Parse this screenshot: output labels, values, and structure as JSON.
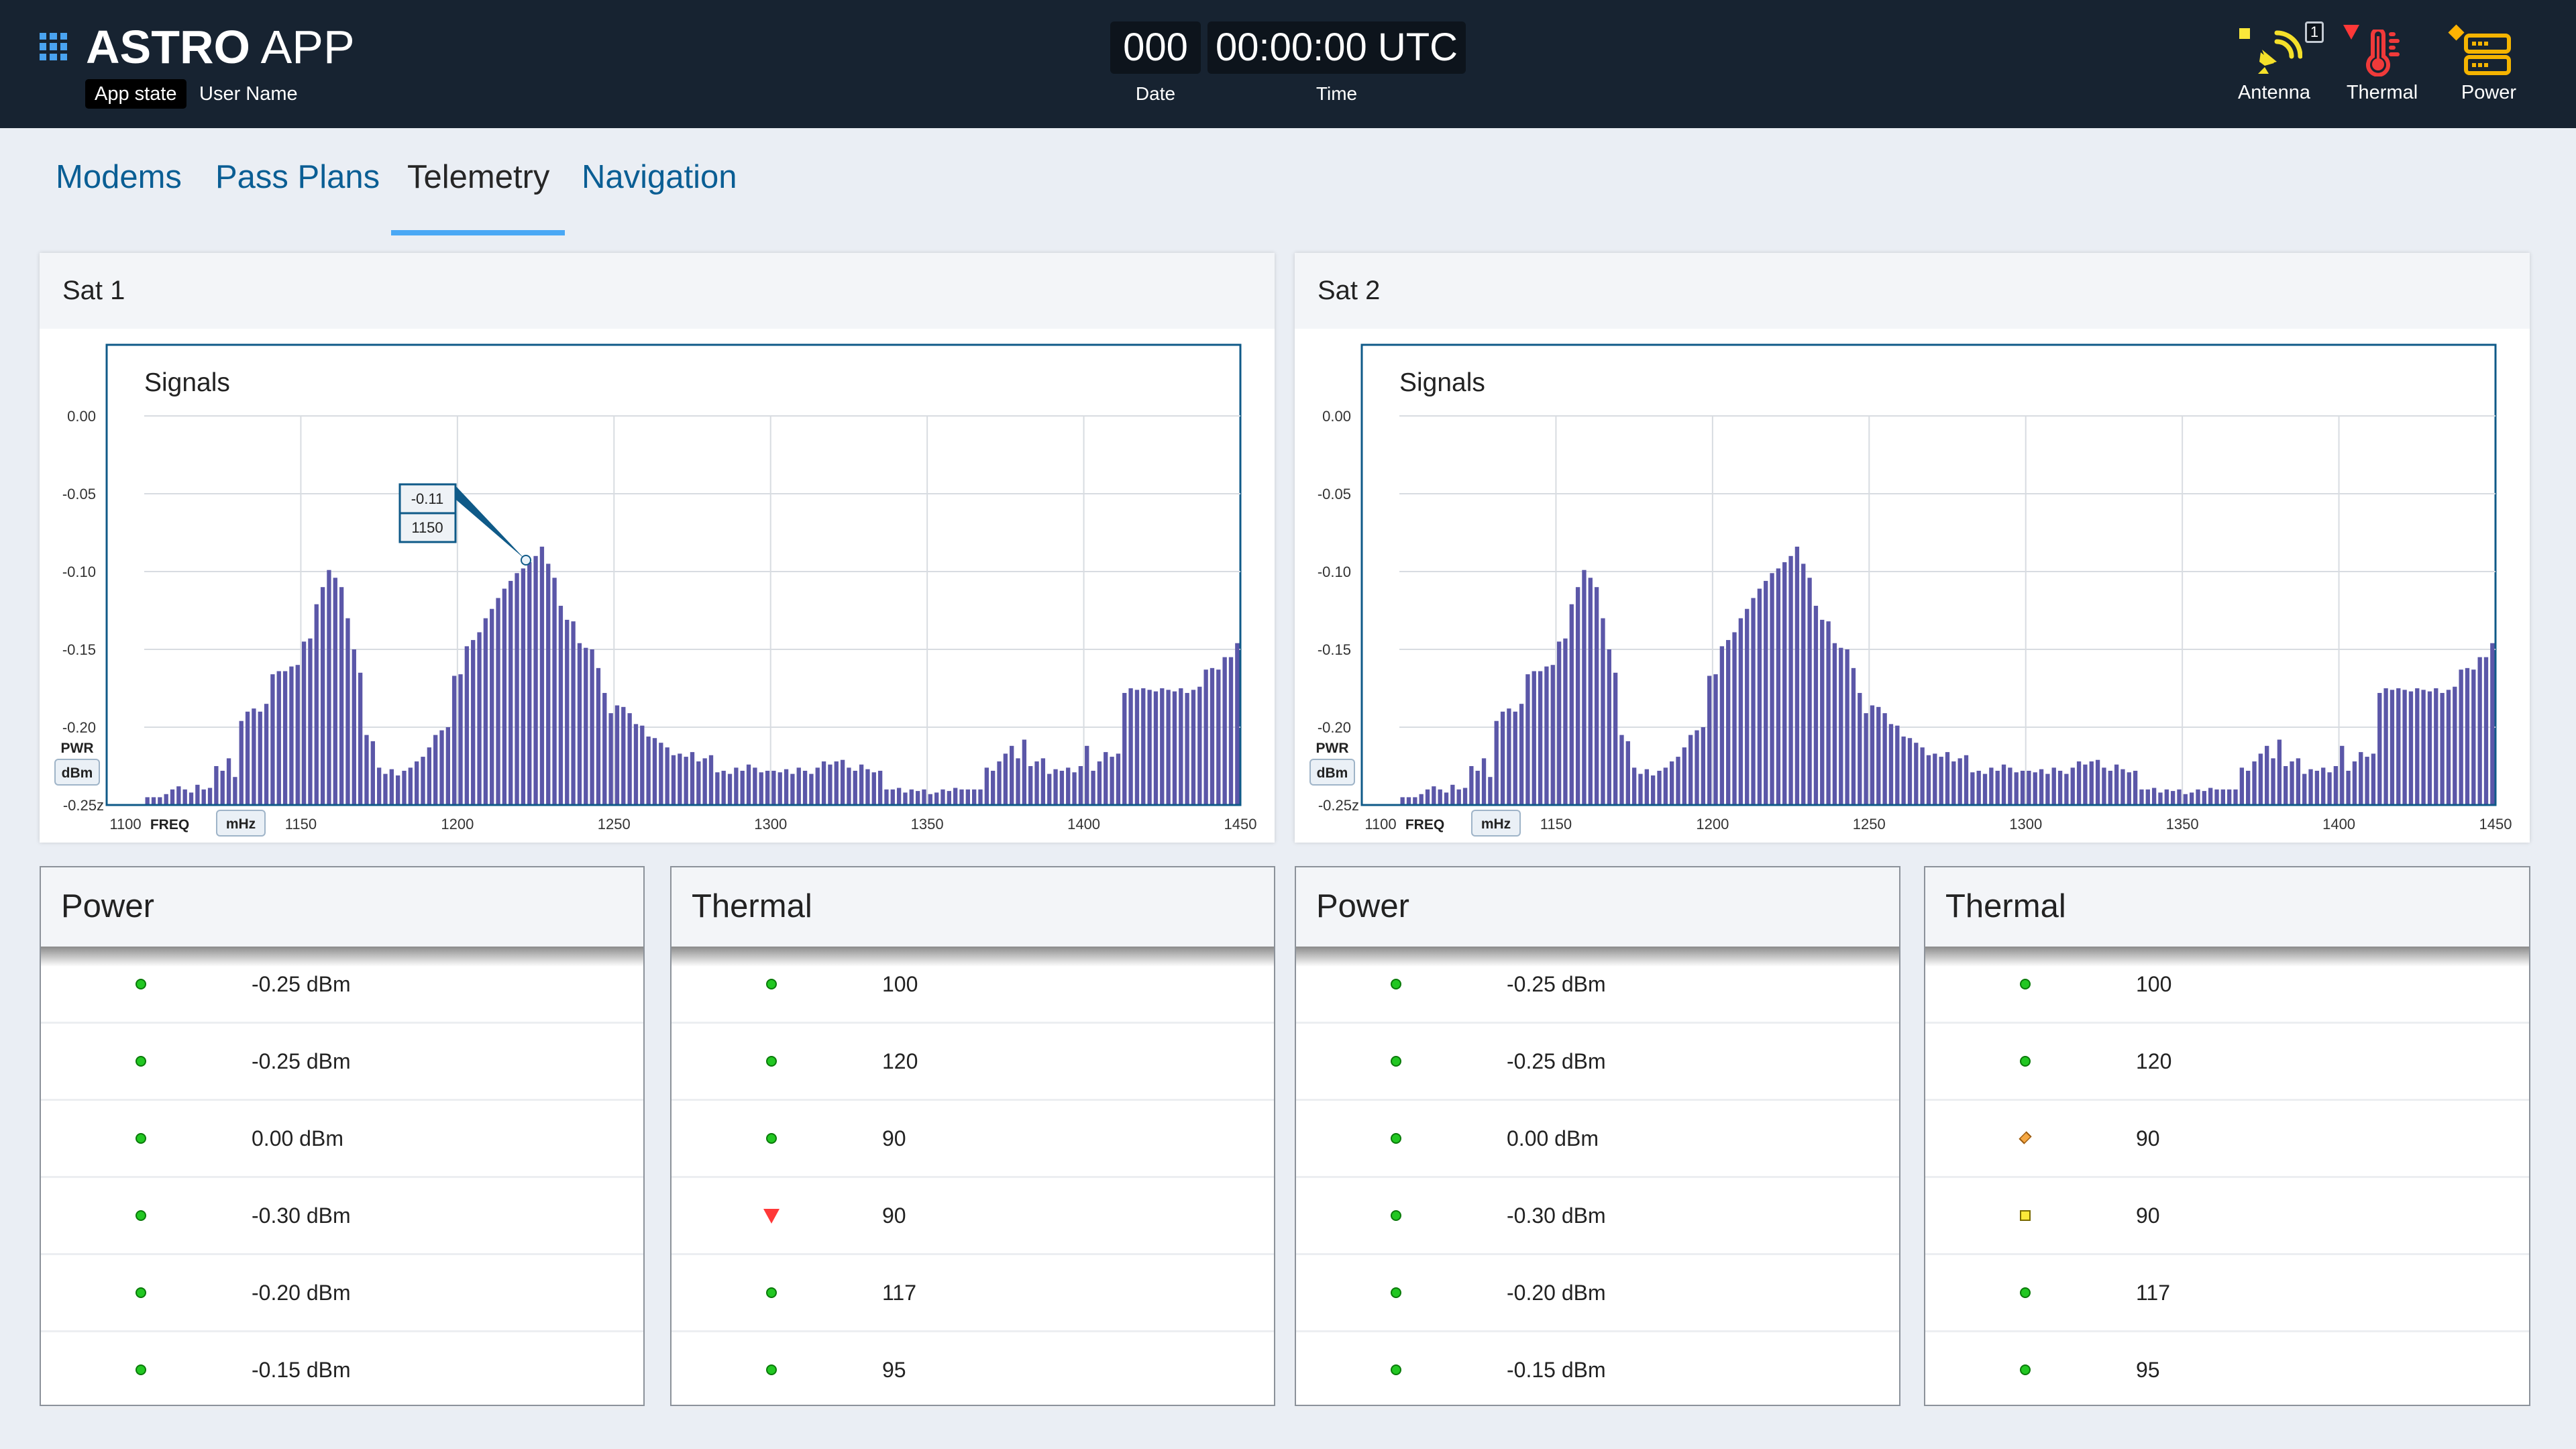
{
  "header": {
    "app_title_bold": "ASTRO",
    "app_title_light": "APP",
    "app_state": "App state",
    "user_name": "User Name",
    "date_value": "000",
    "date_label": "Date",
    "time_value": "00:00:00 UTC",
    "time_label": "Time",
    "indicators": [
      {
        "label": "Antenna",
        "icon": "satellite-dish-icon",
        "status": "caution",
        "status_color": "#fce83a",
        "badge": "1",
        "color": "#f5e02a"
      },
      {
        "label": "Thermal",
        "icon": "thermometer-icon",
        "status": "critical",
        "status_color": "#ff3838",
        "color": "#f03a3a"
      },
      {
        "label": "Power",
        "icon": "power-equipment-icon",
        "status": "serious",
        "status_color": "#ffb302",
        "color": "#f5b400"
      }
    ]
  },
  "tabs": [
    {
      "label": "Modems",
      "active": false
    },
    {
      "label": "Pass Plans",
      "active": false
    },
    {
      "label": "Telemetry",
      "active": true
    },
    {
      "label": "Navigation",
      "active": false
    }
  ],
  "sats": [
    {
      "title": "Sat 1",
      "tooltip": {
        "value": "-0.11",
        "freq": "1150"
      }
    },
    {
      "title": "Sat 2"
    }
  ],
  "chart_data": [
    {
      "type": "bar",
      "title": "Signals",
      "ylabel": "PWR",
      "yunit": "dBm",
      "xlabel": "FREQ",
      "xunit": "mHz",
      "xlim": [
        1100,
        1450
      ],
      "ylim": [
        -0.25,
        0
      ],
      "xticks": [
        "1100",
        "1150",
        "1200",
        "1250",
        "1300",
        "1350",
        "1400",
        "1450"
      ],
      "yticks": [
        "0.00",
        "-0.05",
        "-0.10",
        "-0.15",
        "-0.20",
        "-0.25z"
      ],
      "grid": true,
      "bar_color": "#5b57a8",
      "x_start": 1100,
      "x_step": 2,
      "values": [
        -0.245,
        -0.245,
        -0.245,
        -0.243,
        -0.24,
        -0.238,
        -0.24,
        -0.242,
        -0.237,
        -0.24,
        -0.239,
        -0.225,
        -0.228,
        -0.22,
        -0.232,
        -0.196,
        -0.19,
        -0.188,
        -0.19,
        -0.185,
        -0.166,
        -0.164,
        -0.164,
        -0.161,
        -0.16,
        -0.145,
        -0.143,
        -0.121,
        -0.11,
        -0.099,
        -0.104,
        -0.11,
        -0.13,
        -0.15,
        -0.165,
        -0.205,
        -0.209,
        -0.226,
        -0.23,
        -0.227,
        -0.231,
        -0.228,
        -0.226,
        -0.222,
        -0.219,
        -0.213,
        -0.205,
        -0.202,
        -0.2,
        -0.167,
        -0.166,
        -0.148,
        -0.144,
        -0.139,
        -0.13,
        -0.124,
        -0.117,
        -0.111,
        -0.106,
        -0.101,
        -0.098,
        -0.094,
        -0.09,
        -0.084,
        -0.095,
        -0.104,
        -0.122,
        -0.131,
        -0.132,
        -0.146,
        -0.149,
        -0.15,
        -0.162,
        -0.178,
        -0.191,
        -0.186,
        -0.187,
        -0.191,
        -0.198,
        -0.199,
        -0.206,
        -0.207,
        -0.21,
        -0.213,
        -0.218,
        -0.217,
        -0.219,
        -0.216,
        -0.222,
        -0.22,
        -0.218,
        -0.229,
        -0.228,
        -0.23,
        -0.226,
        -0.228,
        -0.224,
        -0.226,
        -0.229,
        -0.228,
        -0.228,
        -0.229,
        -0.227,
        -0.23,
        -0.226,
        -0.228,
        -0.23,
        -0.226,
        -0.222,
        -0.224,
        -0.222,
        -0.221,
        -0.226,
        -0.228,
        -0.224,
        -0.227,
        -0.229,
        -0.228,
        -0.24,
        -0.24,
        -0.239,
        -0.242,
        -0.24,
        -0.241,
        -0.24,
        -0.243,
        -0.242,
        -0.24,
        -0.241,
        -0.239,
        -0.24,
        -0.24,
        -0.24,
        -0.24,
        -0.226,
        -0.228,
        -0.222,
        -0.217,
        -0.212,
        -0.22,
        -0.208,
        -0.225,
        -0.222,
        -0.22,
        -0.23,
        -0.227,
        -0.228,
        -0.226,
        -0.229,
        -0.225,
        -0.212,
        -0.228,
        -0.222,
        -0.216,
        -0.219,
        -0.217,
        -0.178,
        -0.175,
        -0.176,
        -0.175,
        -0.176,
        -0.177,
        -0.175,
        -0.176,
        -0.177,
        -0.175,
        -0.178,
        -0.176,
        -0.174,
        -0.163,
        -0.162,
        -0.163,
        -0.155,
        -0.155,
        -0.146
      ]
    },
    {
      "type": "bar",
      "title": "Signals",
      "ylabel": "PWR",
      "yunit": "dBm",
      "xlabel": "FREQ",
      "xunit": "mHz",
      "xlim": [
        1100,
        1450
      ],
      "ylim": [
        -0.25,
        0
      ],
      "xticks": [
        "1100",
        "1150",
        "1200",
        "1250",
        "1300",
        "1350",
        "1400",
        "1450"
      ],
      "yticks": [
        "0.00",
        "-0.05",
        "-0.10",
        "-0.15",
        "-0.20",
        "-0.25z"
      ],
      "grid": true,
      "bar_color": "#5b57a8",
      "x_start": 1100,
      "x_step": 2,
      "values": [
        -0.245,
        -0.245,
        -0.245,
        -0.243,
        -0.24,
        -0.238,
        -0.24,
        -0.242,
        -0.237,
        -0.24,
        -0.239,
        -0.225,
        -0.228,
        -0.22,
        -0.232,
        -0.196,
        -0.19,
        -0.188,
        -0.19,
        -0.185,
        -0.166,
        -0.164,
        -0.164,
        -0.161,
        -0.16,
        -0.145,
        -0.143,
        -0.121,
        -0.11,
        -0.099,
        -0.104,
        -0.11,
        -0.13,
        -0.15,
        -0.165,
        -0.205,
        -0.209,
        -0.226,
        -0.23,
        -0.227,
        -0.231,
        -0.228,
        -0.226,
        -0.222,
        -0.219,
        -0.213,
        -0.205,
        -0.202,
        -0.2,
        -0.167,
        -0.166,
        -0.148,
        -0.144,
        -0.139,
        -0.13,
        -0.124,
        -0.117,
        -0.111,
        -0.106,
        -0.101,
        -0.098,
        -0.094,
        -0.09,
        -0.084,
        -0.095,
        -0.104,
        -0.122,
        -0.131,
        -0.132,
        -0.146,
        -0.149,
        -0.15,
        -0.162,
        -0.178,
        -0.191,
        -0.186,
        -0.187,
        -0.191,
        -0.198,
        -0.199,
        -0.206,
        -0.207,
        -0.21,
        -0.213,
        -0.218,
        -0.217,
        -0.219,
        -0.216,
        -0.222,
        -0.22,
        -0.218,
        -0.229,
        -0.228,
        -0.23,
        -0.226,
        -0.228,
        -0.224,
        -0.226,
        -0.229,
        -0.228,
        -0.228,
        -0.229,
        -0.227,
        -0.23,
        -0.226,
        -0.228,
        -0.23,
        -0.226,
        -0.222,
        -0.224,
        -0.222,
        -0.221,
        -0.226,
        -0.228,
        -0.224,
        -0.227,
        -0.229,
        -0.228,
        -0.24,
        -0.24,
        -0.239,
        -0.242,
        -0.24,
        -0.241,
        -0.24,
        -0.243,
        -0.242,
        -0.24,
        -0.241,
        -0.239,
        -0.24,
        -0.24,
        -0.24,
        -0.24,
        -0.226,
        -0.228,
        -0.222,
        -0.217,
        -0.212,
        -0.22,
        -0.208,
        -0.225,
        -0.222,
        -0.22,
        -0.23,
        -0.227,
        -0.228,
        -0.226,
        -0.229,
        -0.225,
        -0.212,
        -0.228,
        -0.222,
        -0.216,
        -0.219,
        -0.217,
        -0.178,
        -0.175,
        -0.176,
        -0.175,
        -0.176,
        -0.177,
        -0.175,
        -0.176,
        -0.177,
        -0.175,
        -0.178,
        -0.176,
        -0.174,
        -0.163,
        -0.162,
        -0.163,
        -0.155,
        -0.155,
        -0.146
      ]
    }
  ],
  "status_colors": {
    "normal": "#22c722",
    "critical": "#ff3838",
    "serious": "#f5a742",
    "caution": "#fce83a"
  },
  "tables": [
    {
      "title": "Power",
      "rows": [
        {
          "status": "normal",
          "value": "-0.25 dBm"
        },
        {
          "status": "normal",
          "value": "-0.25 dBm"
        },
        {
          "status": "normal",
          "value": "0.00 dBm"
        },
        {
          "status": "normal",
          "value": "-0.30 dBm"
        },
        {
          "status": "normal",
          "value": "-0.20 dBm"
        },
        {
          "status": "normal",
          "value": "-0.15 dBm"
        }
      ]
    },
    {
      "title": "Thermal",
      "rows": [
        {
          "status": "normal",
          "value": "100"
        },
        {
          "status": "normal",
          "value": "120"
        },
        {
          "status": "normal",
          "value": "90"
        },
        {
          "status": "critical",
          "value": "90"
        },
        {
          "status": "normal",
          "value": "117"
        },
        {
          "status": "normal",
          "value": "95"
        }
      ]
    },
    {
      "title": "Power",
      "rows": [
        {
          "status": "normal",
          "value": "-0.25 dBm"
        },
        {
          "status": "normal",
          "value": "-0.25 dBm"
        },
        {
          "status": "normal",
          "value": "0.00 dBm"
        },
        {
          "status": "normal",
          "value": "-0.30 dBm"
        },
        {
          "status": "normal",
          "value": "-0.20 dBm"
        },
        {
          "status": "normal",
          "value": "-0.15 dBm"
        }
      ]
    },
    {
      "title": "Thermal",
      "rows": [
        {
          "status": "normal",
          "value": "100"
        },
        {
          "status": "normal",
          "value": "120"
        },
        {
          "status": "serious",
          "value": "90"
        },
        {
          "status": "caution",
          "value": "90"
        },
        {
          "status": "normal",
          "value": "117"
        },
        {
          "status": "normal",
          "value": "95"
        }
      ]
    }
  ]
}
